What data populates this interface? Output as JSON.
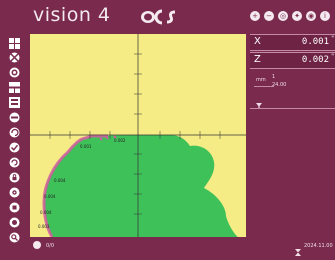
{
  "header": {
    "app_title": "vision 4",
    "logo_icon": "ocs-logo-icon",
    "tool_icons": [
      "zoom-in-icon",
      "zoom-out-icon",
      "target-icon",
      "settings-icon",
      "camera-icon",
      "info-icon"
    ]
  },
  "toolbar": {
    "icons": [
      "grid-icon",
      "crosshair-icon",
      "target-icon",
      "split-view-icon",
      "measure-icon",
      "minus-icon",
      "rotate-icon",
      "check-icon",
      "refresh-icon",
      "lock-icon",
      "gear-icon",
      "stop-icon",
      "record-icon",
      "zoom-icon"
    ]
  },
  "readouts": {
    "x_label": "X",
    "x_value": "0.001",
    "x_unit": "\"",
    "z_label": "Z",
    "z_value": "0.002",
    "z_unit": "\"",
    "mm_label": "mm",
    "mm_value": "1",
    "small_value": "24.00",
    "filter_icon": "funnel-icon"
  },
  "viewport": {
    "labels": [
      "0.002",
      "0.001",
      "0.004",
      "0.004",
      "0.004",
      "0.003"
    ]
  },
  "status": {
    "left_text": "0/0",
    "right_text": "2024.11.00",
    "right_icon": "hourglass-icon"
  },
  "colors": {
    "background": "#7a2a4d",
    "viewport": "#f5ec86",
    "profile_fill": "#3fc15a",
    "deviation": "#cf5d9f"
  }
}
